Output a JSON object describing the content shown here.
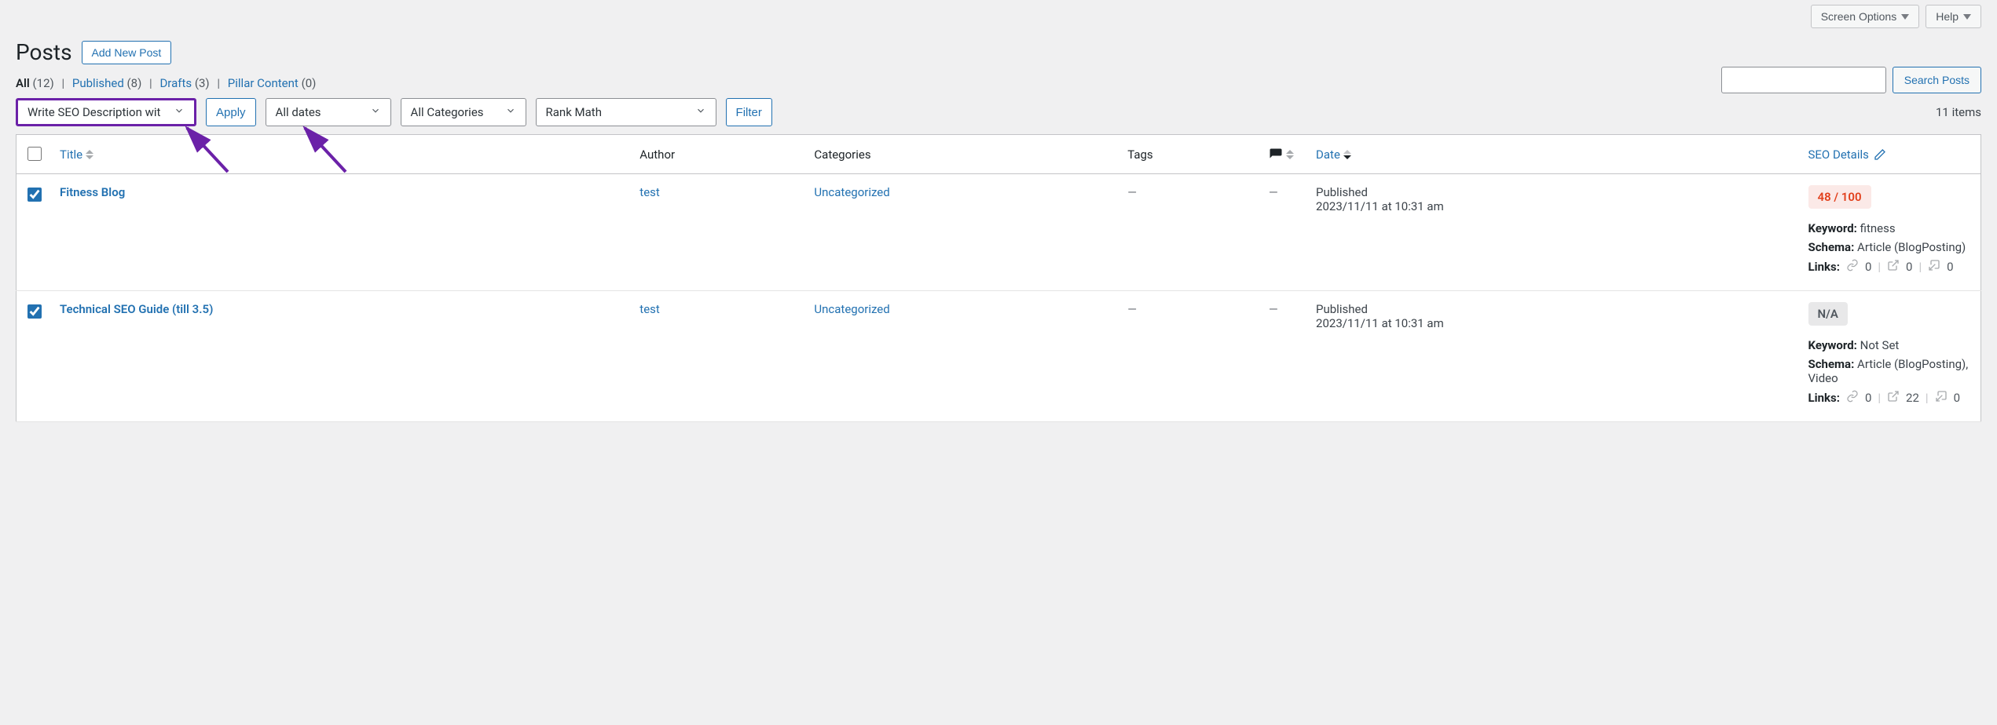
{
  "topbar": {
    "screen_options": "Screen Options",
    "help": "Help"
  },
  "heading": {
    "title": "Posts",
    "add_new": "Add New Post"
  },
  "subsubsub": {
    "all_label": "All",
    "all_count": "(12)",
    "published_label": "Published",
    "published_count": "(8)",
    "drafts_label": "Drafts",
    "drafts_count": "(3)",
    "pillar_label": "Pillar Content",
    "pillar_count": "(0)"
  },
  "search": {
    "button": "Search Posts"
  },
  "filters": {
    "bulk_action": "Write SEO Description wit",
    "apply": "Apply",
    "date": "All dates",
    "category": "All Categories",
    "rankmath": "Rank Math",
    "filter": "Filter",
    "items_count": "11 items"
  },
  "columns": {
    "title": "Title",
    "author": "Author",
    "categories": "Categories",
    "tags": "Tags",
    "date": "Date",
    "seo": "SEO Details"
  },
  "rows": [
    {
      "checked": true,
      "title": "Fitness Blog",
      "author": "test",
      "category": "Uncategorized",
      "tags": "—",
      "comments": "—",
      "date_status": "Published",
      "date_value": "2023/11/11 at 10:31 am",
      "seo": {
        "badge": "48 / 100",
        "badge_class": "bad",
        "keyword_label": "Keyword:",
        "keyword_value": "fitness",
        "schema_label": "Schema:",
        "schema_value": "Article (BlogPosting)",
        "links_label": "Links:",
        "links_internal": "0",
        "links_external": "0",
        "links_incoming": "0"
      }
    },
    {
      "checked": true,
      "title": "Technical SEO Guide (till 3.5)",
      "author": "test",
      "category": "Uncategorized",
      "tags": "—",
      "comments": "—",
      "date_status": "Published",
      "date_value": "2023/11/11 at 10:31 am",
      "seo": {
        "badge": "N/A",
        "badge_class": "na",
        "keyword_label": "Keyword:",
        "keyword_value": "Not Set",
        "schema_label": "Schema:",
        "schema_value": "Article (BlogPosting), Video",
        "links_label": "Links:",
        "links_internal": "0",
        "links_external": "22",
        "links_incoming": "0"
      }
    }
  ]
}
